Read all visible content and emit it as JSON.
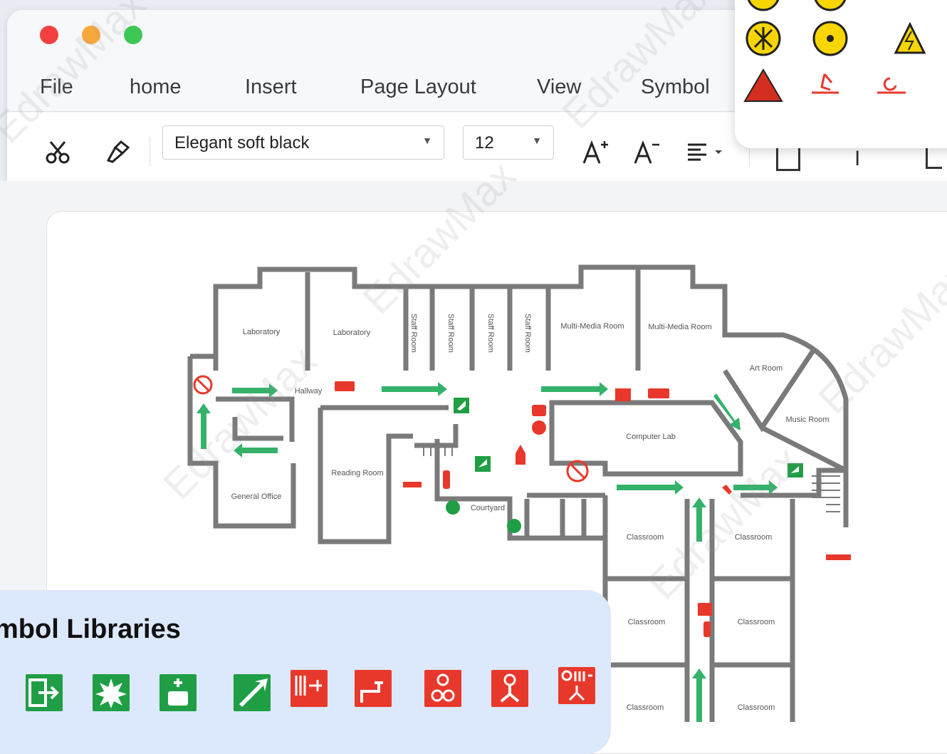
{
  "window": {
    "controls": {
      "close_color": "#f2413f",
      "minimize_color": "#f8a73c",
      "zoom_color": "#3ec756"
    }
  },
  "menu": {
    "items": [
      "File",
      "home",
      "Insert",
      "Page Layout",
      "View",
      "Symbol"
    ]
  },
  "toolbar": {
    "font_name": "Elegant soft black",
    "font_size": "12",
    "icons": [
      "scissors-icon",
      "format-painter-icon",
      "increase-font-icon",
      "decrease-font-icon",
      "align-icon"
    ]
  },
  "floorplan": {
    "rooms": {
      "lab1": "Laboratory",
      "lab2": "Laboratory",
      "staff1": "Staff Room",
      "staff2": "Staff Room",
      "staff3": "Staff Room",
      "staff4": "Staff Room",
      "mm1": "Multi-Media Room",
      "mm2": "Multi-Media Room",
      "art": "Art Room",
      "music": "Music Room",
      "hallway": "Hallway",
      "computer": "Computer Lab",
      "reading": "Reading Room",
      "general": "General Office",
      "courtyard": "Courtyard",
      "class1": "Classroom",
      "class2": "Classroom",
      "class3": "Classroom",
      "class4": "Classroom",
      "class5": "Classroom",
      "class6": "Classroom"
    },
    "colors": {
      "wall": "#7a7a7a",
      "arrow": "#34b26a",
      "red": "#e8382c",
      "green": "#1f9e45"
    }
  },
  "symbol_library": {
    "title": "mbol Libraries",
    "icons": [
      "exit-door-icon",
      "break-glass-icon",
      "first-aid-icon",
      "direction-arrow-icon",
      "fire-hose-icon",
      "fire-tap-icon",
      "fire-valve-icon",
      "sprinkler-icon",
      "fire-hydrant-icon"
    ]
  },
  "hazard_popup": {
    "icons": [
      "yellow-hazard-circle-icon",
      "yellow-radiation-icon",
      "electric-warning-icon",
      "red-danger-triangle-icon",
      "fire-escape-icon",
      "wheelchair-escape-icon"
    ]
  },
  "watermark_text": "EdrawMax"
}
